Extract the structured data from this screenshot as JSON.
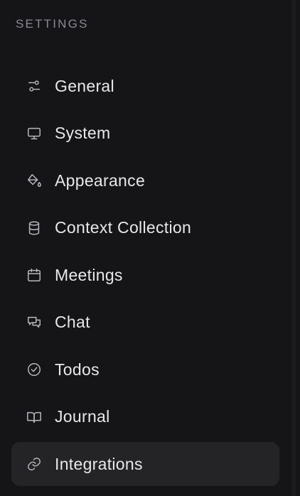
{
  "sidebar": {
    "title": "SETTINGS",
    "items": [
      {
        "label": "General",
        "icon": "sliders-icon",
        "active": false
      },
      {
        "label": "System",
        "icon": "monitor-icon",
        "active": false
      },
      {
        "label": "Appearance",
        "icon": "paint-bucket-icon",
        "active": false
      },
      {
        "label": "Context Collection",
        "icon": "database-icon",
        "active": false
      },
      {
        "label": "Meetings",
        "icon": "calendar-icon",
        "active": false
      },
      {
        "label": "Chat",
        "icon": "chat-bubbles-icon",
        "active": false
      },
      {
        "label": "Todos",
        "icon": "check-circle-icon",
        "active": false
      },
      {
        "label": "Journal",
        "icon": "book-open-icon",
        "active": false
      },
      {
        "label": "Integrations",
        "icon": "link-icon",
        "active": true
      }
    ]
  },
  "colors": {
    "background": "#151517",
    "active_item": "#242427",
    "text": "#e8e8ea",
    "muted_text": "#8a8a90",
    "icon": "#b9b9bd"
  }
}
